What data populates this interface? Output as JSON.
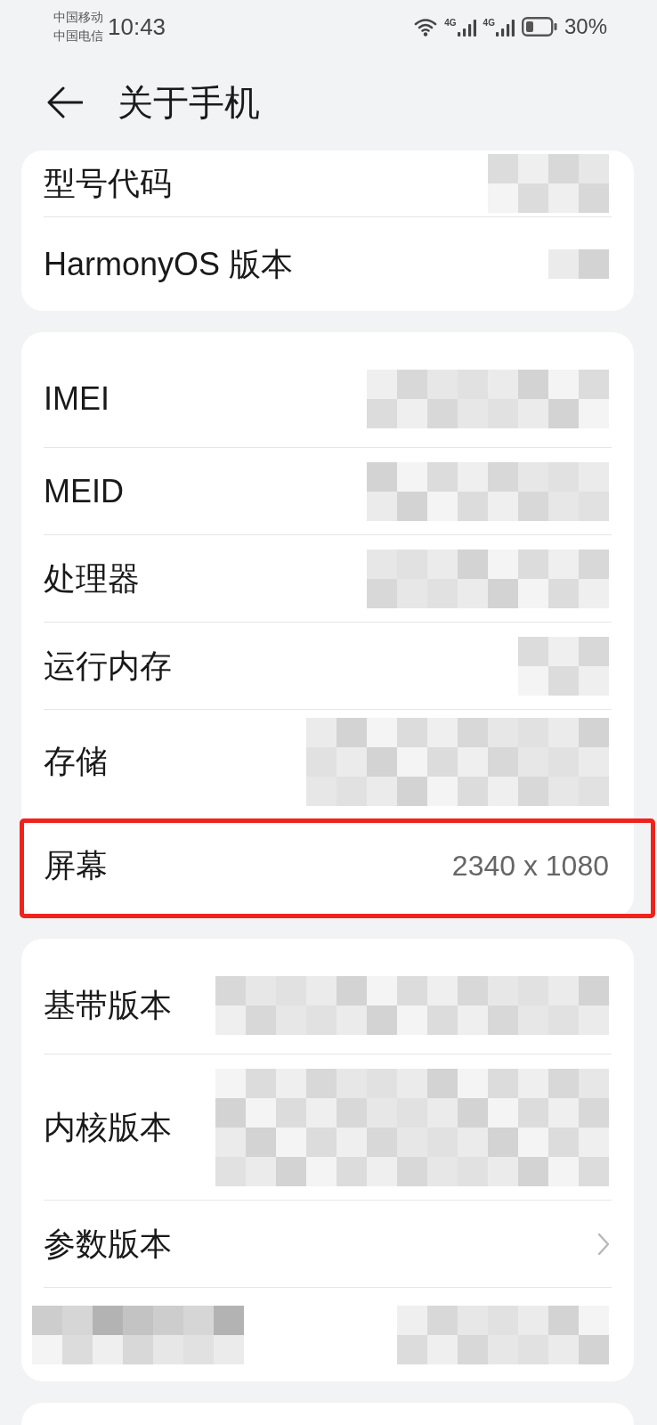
{
  "status_bar": {
    "carriers": [
      "中国移动",
      "中国电信"
    ],
    "time": "10:43",
    "signals": [
      {
        "label": "4G"
      },
      {
        "label": "4G"
      }
    ],
    "battery_text": "30%"
  },
  "header": {
    "title": "关于手机"
  },
  "cards": [
    {
      "rows": [
        {
          "kind": "info",
          "label": "型号代码",
          "redacted": true,
          "highlighted": false
        },
        {
          "kind": "info",
          "label": "HarmonyOS 版本",
          "redacted": true,
          "highlighted": false
        }
      ]
    },
    {
      "rows": [
        {
          "kind": "info",
          "label": "IMEI",
          "redacted": true,
          "highlighted": false
        },
        {
          "kind": "info",
          "label": "MEID",
          "redacted": true,
          "highlighted": false
        },
        {
          "kind": "info",
          "label": "处理器",
          "redacted": true,
          "highlighted": false
        },
        {
          "kind": "info",
          "label": "运行内存",
          "redacted": true,
          "highlighted": false
        },
        {
          "kind": "info",
          "label": "存储",
          "redacted": true,
          "highlighted": false
        },
        {
          "kind": "info",
          "label": "屏幕",
          "value": "2340 x 1080",
          "redacted": false,
          "highlighted": true
        }
      ]
    },
    {
      "rows": [
        {
          "kind": "info",
          "label": "基带版本",
          "redacted": true,
          "highlighted": false
        },
        {
          "kind": "info",
          "label": "内核版本",
          "redacted": true,
          "highlighted": false
        },
        {
          "kind": "link",
          "label": "参数版本",
          "redacted": false,
          "highlighted": false
        },
        {
          "kind": "masked",
          "redacted": true,
          "highlighted": false
        }
      ]
    }
  ]
}
